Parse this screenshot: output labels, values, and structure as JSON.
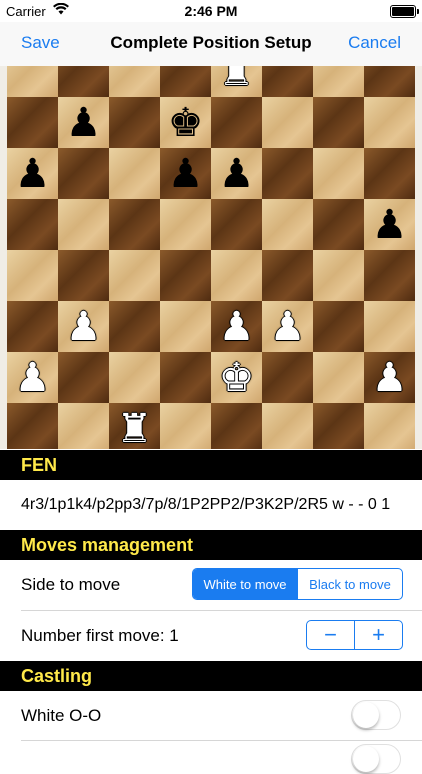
{
  "status_bar": {
    "carrier": "Carrier",
    "time": "2:46 PM"
  },
  "nav": {
    "save": "Save",
    "title": "Complete Position Setup",
    "cancel": "Cancel"
  },
  "board": {
    "rows": [
      [
        "",
        "",
        "",
        "",
        "R",
        "",
        "",
        ""
      ],
      [
        "",
        "p",
        "",
        "k",
        "",
        "",
        "",
        ""
      ],
      [
        "p",
        "",
        "",
        "p",
        "p",
        "",
        "",
        ""
      ],
      [
        "",
        "",
        "",
        "",
        "",
        "",
        "",
        "p"
      ],
      [
        "",
        "",
        "",
        "",
        "",
        "",
        "",
        ""
      ],
      [
        "",
        "P",
        "",
        "",
        "P",
        "P",
        "",
        ""
      ],
      [
        "P",
        "",
        "",
        "",
        "K",
        "",
        "",
        "P"
      ],
      [
        "",
        "",
        "R",
        "",
        "",
        "",
        "",
        ""
      ]
    ],
    "piece_glyphs": {
      "K": "♚",
      "Q": "♛",
      "R": "♜",
      "B": "♝",
      "N": "♞",
      "P": "♟",
      "k": "♚",
      "q": "♛",
      "r": "♜",
      "b": "♝",
      "n": "♞",
      "p": "♟"
    }
  },
  "fen": {
    "header": "FEN",
    "value": "4r3/1p1k4/p2pp3/7p/8/1P2PP2/P3K2P/2R5 w - - 0 1"
  },
  "moves": {
    "header": "Moves management",
    "side_label": "Side to move",
    "white_option": "White to move",
    "black_option": "Black to move",
    "number_label": "Number first move: 1",
    "minus": "−",
    "plus": "+"
  },
  "castling": {
    "header": "Castling",
    "white_oo": "White O-O",
    "white_oo_on": false
  },
  "colors": {
    "accent": "#1a7cf0",
    "section_bg": "#000000",
    "section_text": "#ffe94a"
  }
}
